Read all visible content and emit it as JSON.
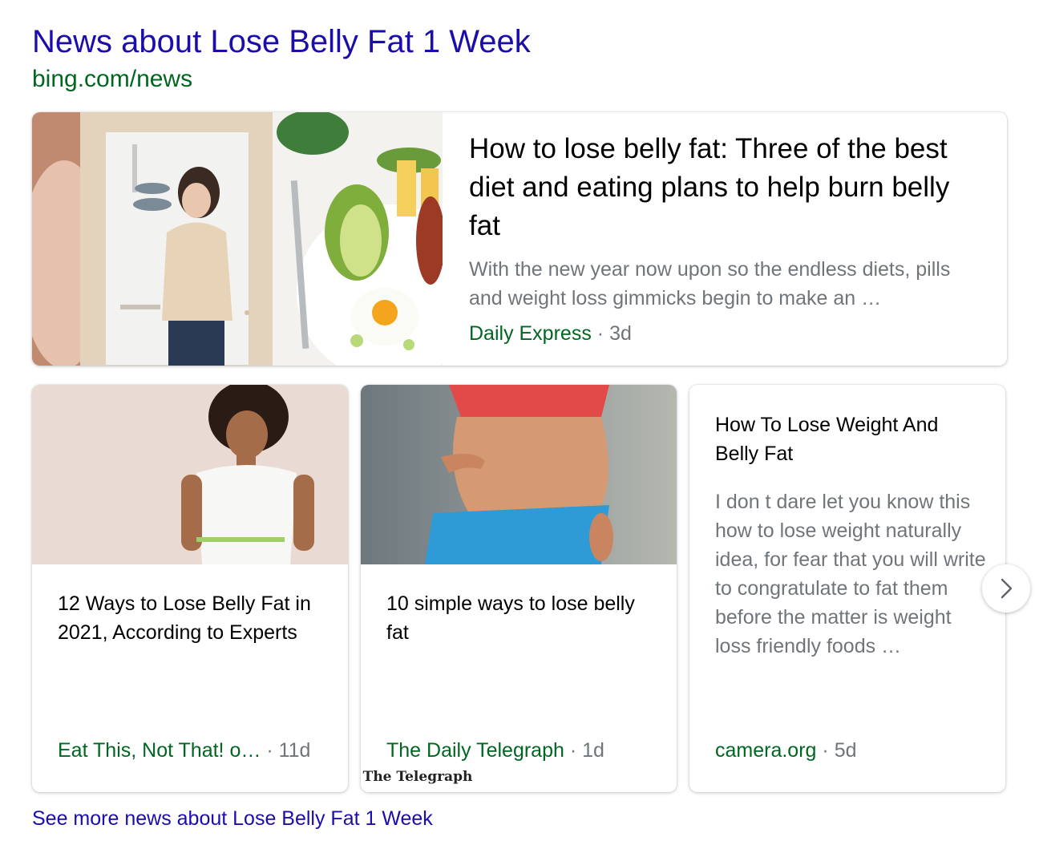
{
  "header": {
    "title": "News about Lose Belly Fat 1 Week",
    "url": "bing.com/news"
  },
  "featured": {
    "title": "How to lose belly fat: Three of the best diet and eating plans to help burn belly fat",
    "snippet": "With the new year now upon so the endless diets, pills and weight loss gimmicks begin to make an …",
    "source": "Daily Express",
    "separator": "·",
    "age": "3d",
    "image": "woman-in-mirror-and-breakfast-plate-photo"
  },
  "cards": [
    {
      "title": "12 Ways to Lose Belly Fat in 2021, According to Experts",
      "source": "Eat This, Not That! o…",
      "separator": "·",
      "age": "11d",
      "image": "smiling-woman-measuring-waist-photo"
    },
    {
      "title": "10 simple ways to lose belly fat",
      "source": "The Daily Telegraph",
      "separator": "·",
      "age": "1d",
      "badge": "The Telegraph",
      "image": "woman-pinching-belly-photo"
    },
    {
      "title": "How To Lose Weight And Belly Fat",
      "snippet": "I don t dare let you know this how to lose weight naturally idea, for fear that you will write to congratulate to fat them before the matter is weight loss friendly foods …",
      "source": "camera.org",
      "separator": "·",
      "age": "5d"
    }
  ],
  "next_icon": "chevron-right-icon",
  "more_link": "See more news about Lose Belly Fat 1 Week",
  "colors": {
    "link": "#1a0dab",
    "source_green": "#006621",
    "muted": "#70757a"
  }
}
